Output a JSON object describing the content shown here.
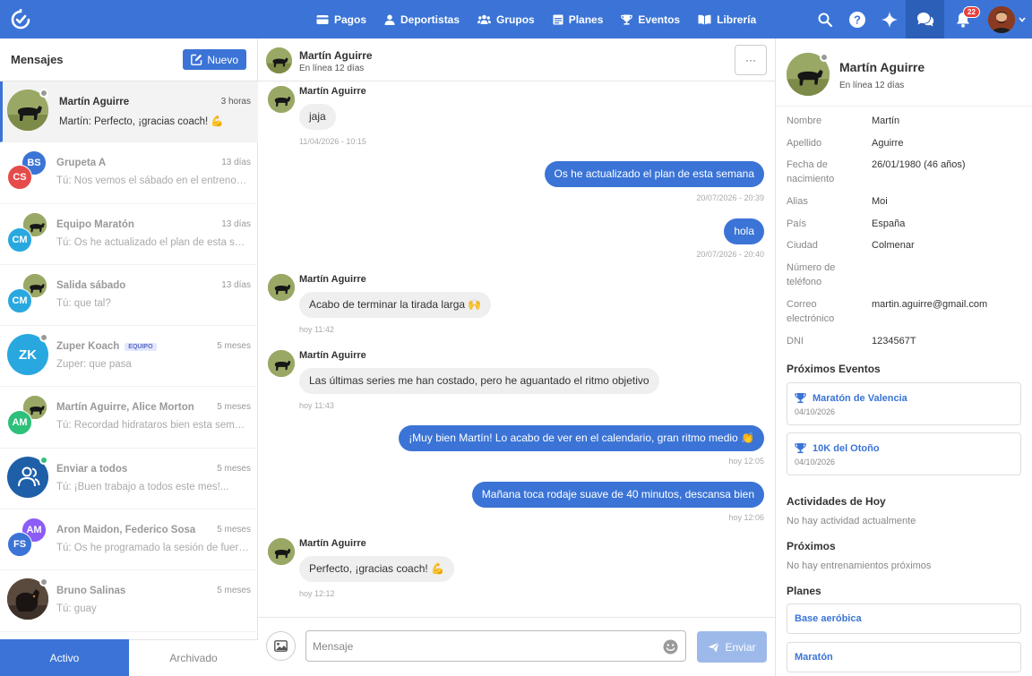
{
  "nav": {
    "links": [
      {
        "label": "Pagos",
        "icon": "card-icon"
      },
      {
        "label": "Deportistas",
        "icon": "person-icon"
      },
      {
        "label": "Grupos",
        "icon": "group-icon"
      },
      {
        "label": "Planes",
        "icon": "calendar-icon"
      },
      {
        "label": "Eventos",
        "icon": "trophy-icon"
      },
      {
        "label": "Librería",
        "icon": "book-icon"
      }
    ],
    "notifications_count": "22"
  },
  "left": {
    "title": "Mensajes",
    "new_button": "Nuevo",
    "conversations": [
      {
        "name": "Martín Aguirre",
        "time": "3 horas",
        "preview": "Martín: Perfecto, ¡gracias coach! 💪",
        "active": true
      },
      {
        "name": "Grupeta A",
        "time": "13 días",
        "preview": "Tú: Nos vemos el sábado en el entreno de...",
        "initials": [
          "BS",
          "CS"
        ],
        "colors": [
          "#3b74d6",
          "#e54b4b"
        ]
      },
      {
        "name": "Equipo Maratón",
        "time": "13 días",
        "preview": "Tú: Os he actualizado el plan de esta semana",
        "initials": [
          "CM"
        ],
        "colors": [
          "#29a8e0"
        ]
      },
      {
        "name": "Salida sábado",
        "time": "13 días",
        "preview": "Tú: que tal?",
        "initials": [
          "CM"
        ],
        "colors": [
          "#29a8e0"
        ]
      },
      {
        "name": "Zuper Koach",
        "tag": "EQUIPO",
        "time": "5 meses",
        "preview": "Zuper: que pasa",
        "initials": [
          "ZK"
        ],
        "colors": [
          "#29a8e0"
        ]
      },
      {
        "name": "Martín Aguirre, Alice Morton",
        "time": "5 meses",
        "preview": "Tú: Recordad hidrataros bien esta semana",
        "initials": [
          "AM"
        ],
        "colors": [
          "#2ec07a"
        ]
      },
      {
        "name": "Enviar a todos",
        "time": "5 meses",
        "preview": "Tú: ¡Buen trabajo a todos este mes!...",
        "colors": [
          "#1f5fa8"
        ]
      },
      {
        "name": "Aron Maidon, Federico Sosa",
        "time": "5 meses",
        "preview": "Tú: Os he programado la sesión de fuerza...",
        "initials": [
          "AM",
          "FS"
        ],
        "colors": [
          "#8b5cf6",
          "#3b74d6"
        ]
      },
      {
        "name": "Bruno Salinas",
        "time": "5 meses",
        "preview": "Tú: guay"
      }
    ],
    "tabs": {
      "active": "Activo",
      "archived": "Archivado"
    }
  },
  "chat": {
    "contact_name": "Martín Aguirre",
    "contact_status": "En línea 12 días",
    "more_label": "···",
    "messages": [
      {
        "dir": "in",
        "sender": "Martín Aguirre",
        "text": "jaja",
        "time": "11/04/2026 - 10:15"
      },
      {
        "dir": "out",
        "text": "Os he actualizado el plan de esta semana",
        "time": "20/07/2026 - 20:39"
      },
      {
        "dir": "out",
        "text": "hola",
        "time": "20/07/2026 - 20:40"
      },
      {
        "dir": "in",
        "sender": "Martín Aguirre",
        "text": "Acabo de terminar la tirada larga 🙌",
        "time": "hoy 11:42"
      },
      {
        "dir": "in",
        "sender": "Martín Aguirre",
        "text": "Las últimas series me han costado, pero he aguantado el ritmo objetivo",
        "time": "hoy 11:43"
      },
      {
        "dir": "out",
        "text": "¡Muy bien Martín! Lo acabo de ver en el calendario, gran ritmo medio 👏",
        "time": "hoy 12:05"
      },
      {
        "dir": "out",
        "text": "Mañana toca rodaje suave de 40 minutos, descansa bien",
        "time": "hoy 12:06"
      },
      {
        "dir": "in",
        "sender": "Martín Aguirre",
        "text": "Perfecto, ¡gracias coach! 💪",
        "time": "hoy 12:12"
      }
    ],
    "input_placeholder": "Mensaje",
    "send_label": "Enviar"
  },
  "profile": {
    "name": "Martín Aguirre",
    "status": "En línea 12 días",
    "fields": [
      {
        "label": "Nombre",
        "value": "Martín"
      },
      {
        "label": "Apellido",
        "value": "Aguirre"
      },
      {
        "label": "Fecha de nacimiento",
        "value": "26/01/1980 (46 años)"
      },
      {
        "label": "Alias",
        "value": "Moi"
      },
      {
        "label": "País",
        "value": "España"
      },
      {
        "label": "Ciudad",
        "value": "Colmenar"
      },
      {
        "label": "Número de teléfono",
        "value": ""
      },
      {
        "label": "Correo electrónico",
        "value": "martin.aguirre@gmail.com"
      },
      {
        "label": "DNI",
        "value": "1234567T"
      }
    ],
    "events_title": "Próximos Eventos",
    "events": [
      {
        "name": "Maratón de Valencia",
        "date": "04/10/2026"
      },
      {
        "name": "10K del Otoño",
        "date": "04/10/2026"
      }
    ],
    "today_title": "Actividades de Hoy",
    "today_empty": "No hay actividad actualmente",
    "next_title": "Próximos",
    "next_empty": "No hay entrenamientos próximos",
    "plans_title": "Planes",
    "plans": [
      "Base aeróbica",
      "Maratón"
    ]
  },
  "colors": {
    "primary": "#3b74d6",
    "send_disabled": "#9db9ea",
    "online": "#2ec07a",
    "offline": "#999999"
  }
}
